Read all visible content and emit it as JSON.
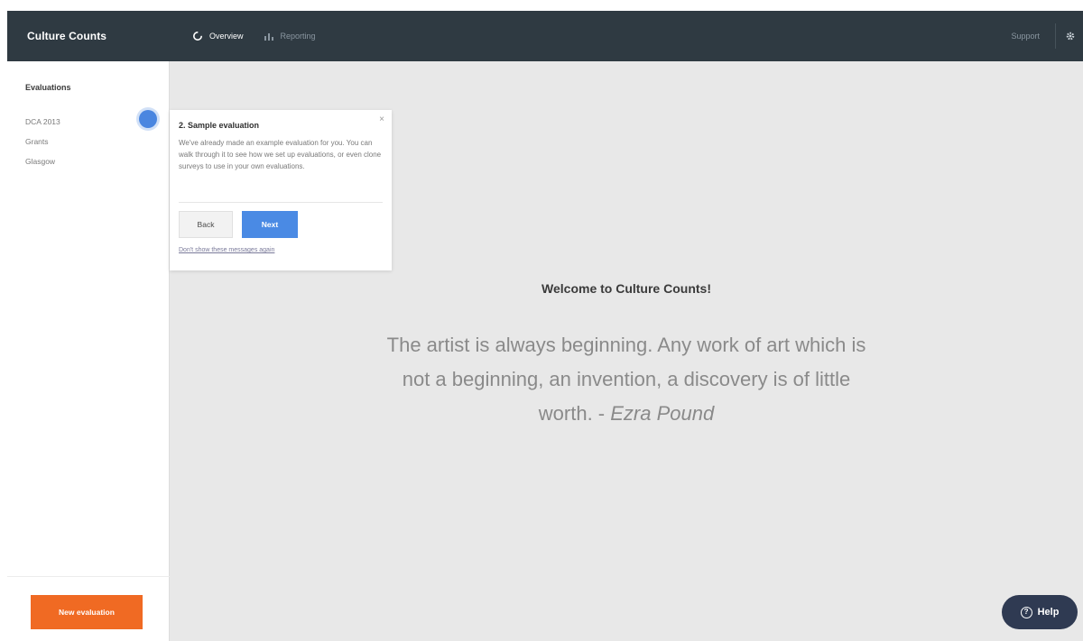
{
  "header": {
    "brand": "Culture Counts",
    "nav": [
      {
        "label": "Overview",
        "icon": "overview-ring-icon",
        "active": true
      },
      {
        "label": "Reporting",
        "icon": "bar-chart-icon",
        "active": false
      }
    ],
    "support_label": "Support",
    "settings_icon": "gear-icon"
  },
  "sidebar": {
    "title": "Evaluations",
    "items": [
      {
        "label": "DCA 2013"
      },
      {
        "label": "Grants"
      },
      {
        "label": "Glasgow"
      }
    ],
    "new_evaluation_label": "New evaluation"
  },
  "popover": {
    "title": "2. Sample evaluation",
    "body": "We've already made an example evaluation for you. You can walk through it to see how we set up evaluations, or even clone surveys to use in your own evaluations.",
    "back_label": "Back",
    "next_label": "Next",
    "dont_show_label": "Don't show these messages again",
    "close_glyph": "×"
  },
  "main": {
    "welcome": "Welcome to Culture Counts!",
    "quote_text": "The artist is always beginning. Any work of art which is not a beginning, an invention, a discovery is of little worth. - ",
    "quote_author": "Ezra Pound"
  },
  "help": {
    "label": "Help",
    "icon_glyph": "?"
  },
  "colors": {
    "topbar": "#2f3a42",
    "accent_orange": "#f06a23",
    "accent_blue": "#4a8ae4",
    "help_button": "#2f3a52",
    "content_bg": "#e8e8e8"
  }
}
